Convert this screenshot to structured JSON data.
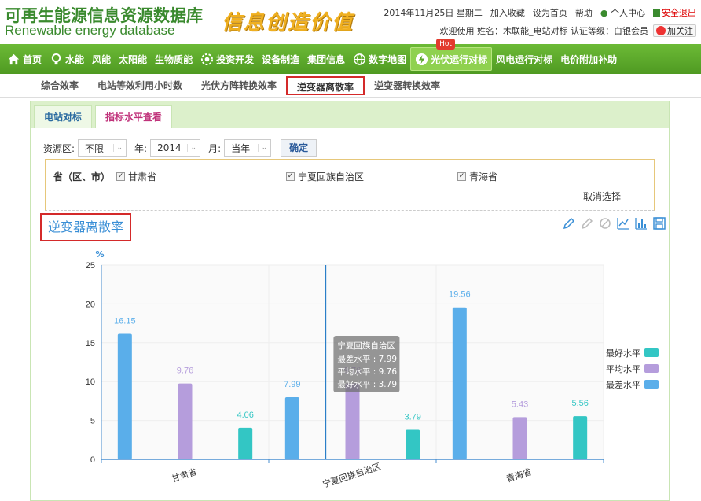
{
  "header": {
    "logo_cn": "可再生能源信息资源数据库",
    "logo_en": "Renewable energy database",
    "slogan": "信息创造价值",
    "date": "2014年11月25日 星期二",
    "add_favorite": "加入收藏",
    "set_home": "设为首页",
    "help": "帮助",
    "user_center": "个人中心",
    "logout": "安全退出",
    "welcome": "欢迎使用 姓名：木联能_电站对标 认证等级：白银会员",
    "follow": "加关注"
  },
  "nav": {
    "items": [
      {
        "label": "首页",
        "icon": "home-icon"
      },
      {
        "label": "水能",
        "icon": "bulb-icon"
      },
      {
        "label": "风能",
        "icon": ""
      },
      {
        "label": "太阳能",
        "icon": ""
      },
      {
        "label": "生物质能",
        "icon": ""
      },
      {
        "label": "投资开发",
        "icon": "settings-icon"
      },
      {
        "label": "设备制造",
        "icon": ""
      },
      {
        "label": "集团信息",
        "icon": ""
      },
      {
        "label": "数字地图",
        "icon": "globe-icon"
      },
      {
        "label": "光伏运行对标",
        "icon": "lightning-icon"
      },
      {
        "label": "风电运行对标",
        "icon": ""
      },
      {
        "label": "电价附加补助",
        "icon": ""
      }
    ],
    "hot_badge": "Hot"
  },
  "subnav": {
    "items": [
      "综合效率",
      "电站等效利用小时数",
      "光伏方阵转换效率",
      "逆变器离散率",
      "逆变器转换效率"
    ]
  },
  "tabs": [
    "电站对标",
    "指标水平查看"
  ],
  "filter": {
    "source_label": "资源区:",
    "source_value": "不限",
    "year_label": "年:",
    "year_value": "2014",
    "month_label": "月:",
    "month_value": "当年",
    "confirm": "确定"
  },
  "region": {
    "label": "省（区、市）",
    "checkboxes": [
      "甘肃省",
      "宁夏回族自治区",
      "青海省"
    ],
    "check_mark": "✓",
    "cancel": "取消选择"
  },
  "chart_title": "逆变器离散率",
  "chart_data": {
    "type": "bar",
    "title": "逆变器离散率",
    "ylabel": "%",
    "ylim": [
      0,
      25
    ],
    "yticks": [
      0,
      5,
      10,
      15,
      20,
      25
    ],
    "categories": [
      "甘肃省",
      "宁夏回族自治区",
      "青海省"
    ],
    "series": [
      {
        "name": "最差水平",
        "color": "#5aaeea",
        "values": [
          16.15,
          7.99,
          19.56
        ]
      },
      {
        "name": "平均水平",
        "color": "#b59ddc",
        "values": [
          9.76,
          9.76,
          5.43
        ]
      },
      {
        "name": "最好水平",
        "color": "#33c6c4",
        "values": [
          4.06,
          3.79,
          5.56
        ]
      }
    ],
    "legend_order": [
      "最好水平",
      "平均水平",
      "最差水平"
    ],
    "legend": "right",
    "grid": true,
    "tooltip": {
      "title": "宁夏回族自治区",
      "lines": [
        "最差水平 : 7.99",
        "平均水平 : 9.76",
        "最好水平 : 3.79"
      ]
    }
  }
}
